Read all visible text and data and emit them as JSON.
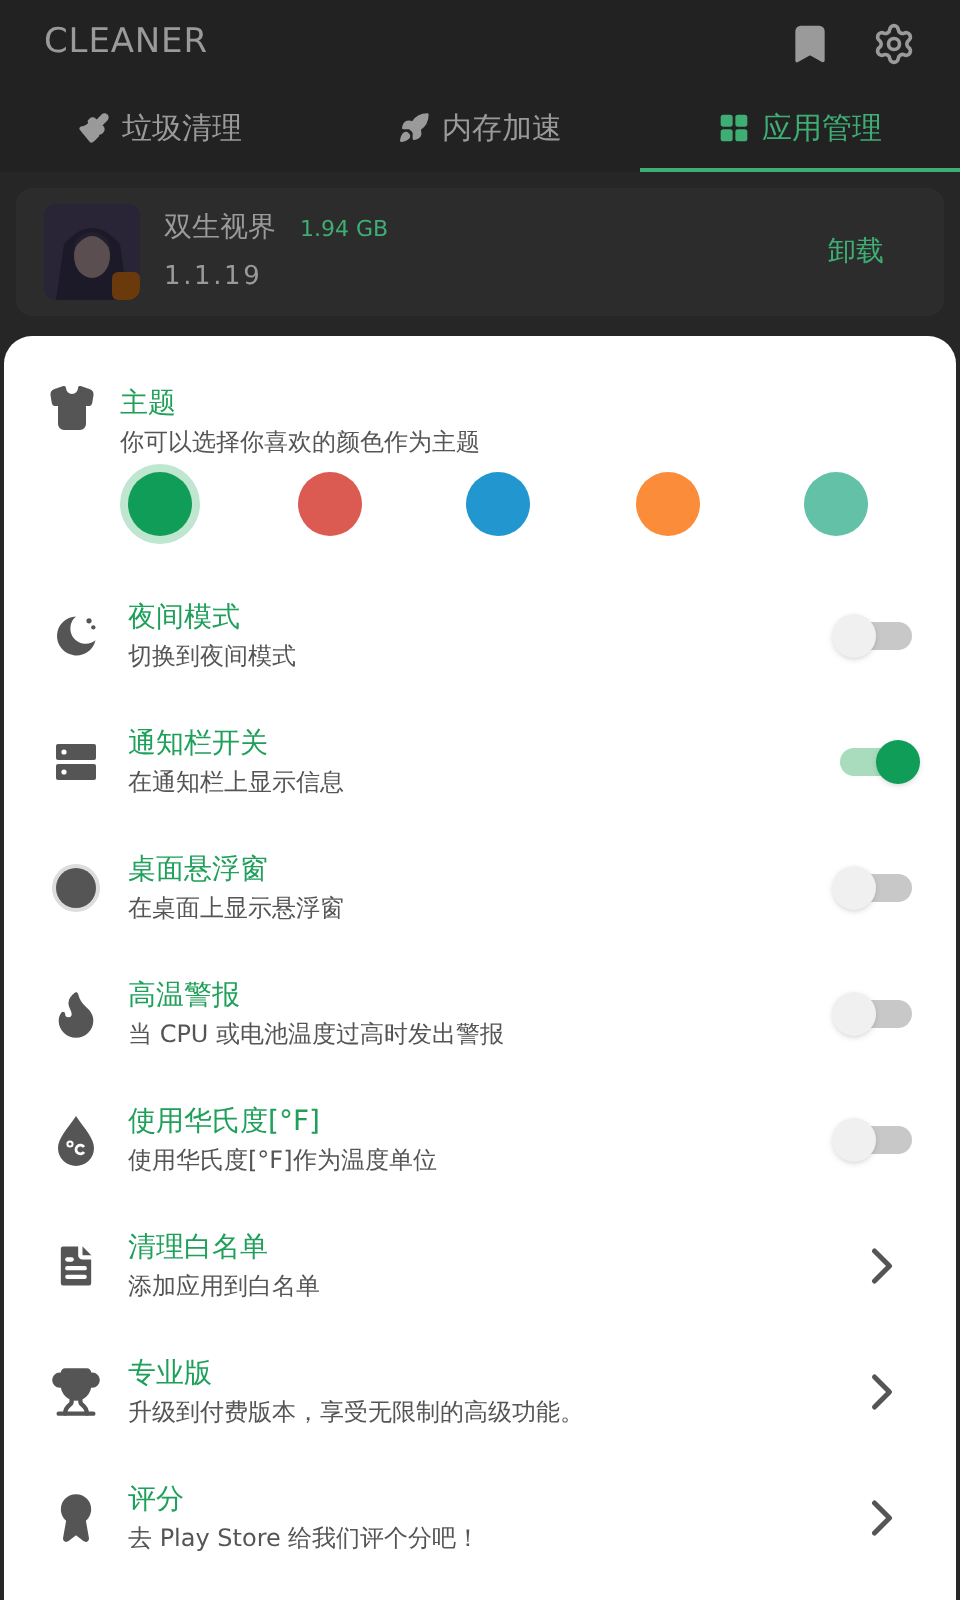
{
  "app_bar": {
    "title": "CLEANER"
  },
  "tabs": [
    {
      "label": "垃圾清理",
      "selected": false
    },
    {
      "label": "内存加速",
      "selected": false
    },
    {
      "label": "应用管理",
      "selected": true
    }
  ],
  "app_item": {
    "name": "双生视界",
    "size": "1.94 GB",
    "version": "1.1.19",
    "action": "卸载"
  },
  "theme": {
    "title": "主题",
    "subtitle": "你可以选择你喜欢的颜色作为主题",
    "colors": [
      {
        "color": "#0f9d58",
        "selected": true
      },
      {
        "color": "#db5a52",
        "selected": false
      },
      {
        "color": "#2196cf",
        "selected": false
      },
      {
        "color": "#fb8c3a",
        "selected": false
      },
      {
        "color": "#63c1a8",
        "selected": false
      }
    ]
  },
  "settings": [
    {
      "kind": "toggle",
      "title": "夜间模式",
      "subtitle": "切换到夜间模式",
      "on": false
    },
    {
      "kind": "toggle",
      "title": "通知栏开关",
      "subtitle": "在通知栏上显示信息",
      "on": true
    },
    {
      "kind": "toggle",
      "title": "桌面悬浮窗",
      "subtitle": "在桌面上显示悬浮窗",
      "on": false
    },
    {
      "kind": "toggle",
      "title": "高温警报",
      "subtitle": "当 CPU 或电池温度过高时发出警报",
      "on": false
    },
    {
      "kind": "toggle",
      "title": "使用华氏度[°F]",
      "subtitle": "使用华氏度[°F]作为温度单位",
      "on": false
    },
    {
      "kind": "link",
      "title": "清理白名单",
      "subtitle": "添加应用到白名单"
    },
    {
      "kind": "link",
      "title": "专业版",
      "subtitle": "升级到付费版本，享受无限制的高级功能。"
    },
    {
      "kind": "link",
      "title": "评分",
      "subtitle": "去 Play Store 给我们评个分吧！"
    }
  ]
}
